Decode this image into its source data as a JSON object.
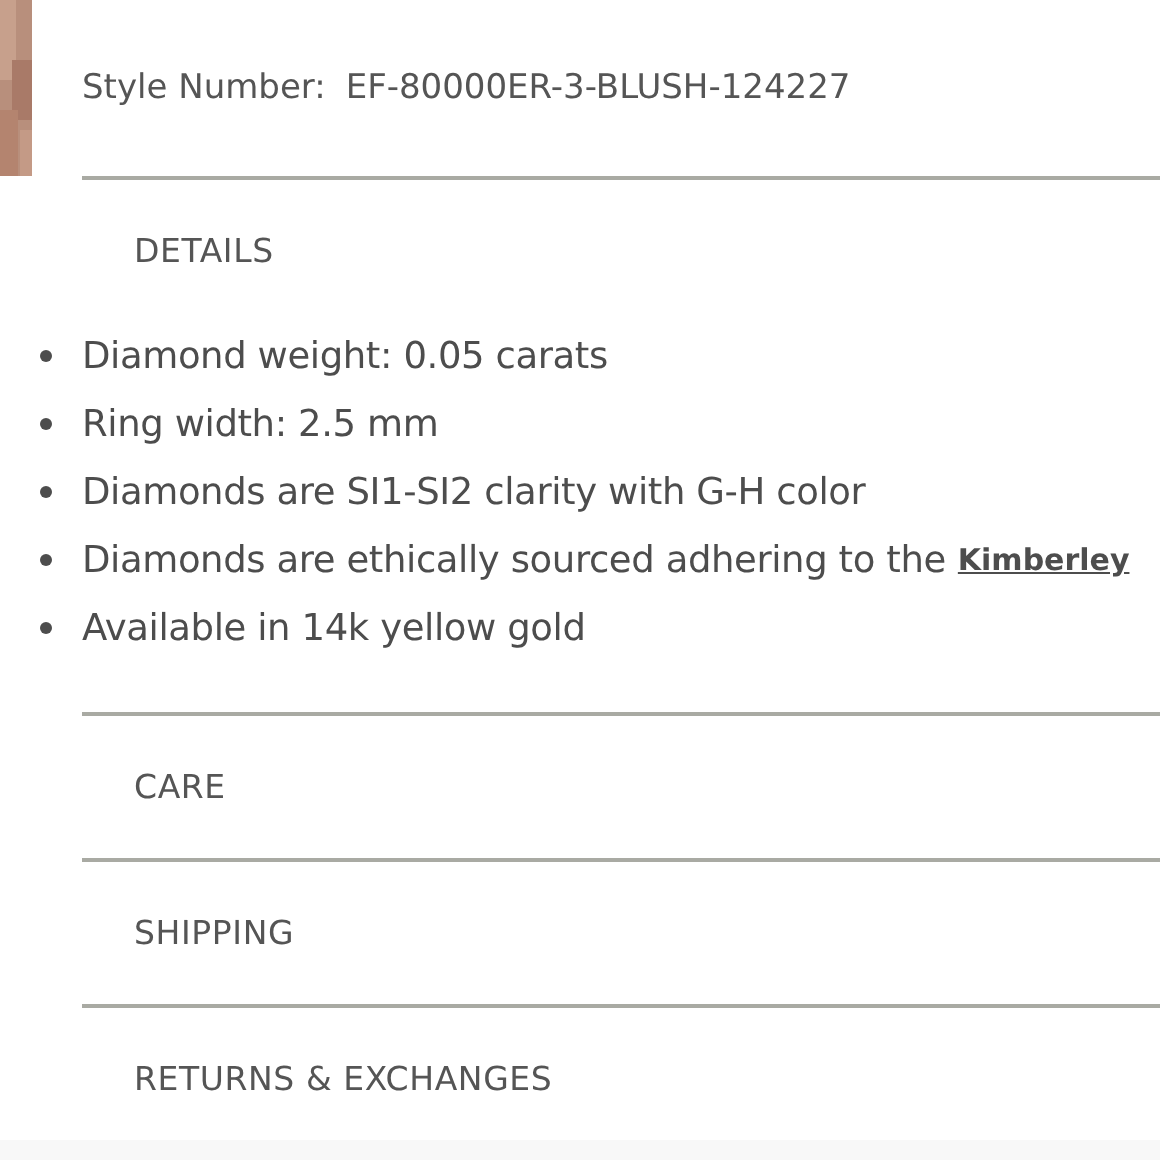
{
  "style_number": {
    "label": "Style Number:",
    "value": "EF-80000ER-3-BLUSH-124227"
  },
  "sections": [
    {
      "title": "DETAILS",
      "items": [
        {
          "text": "Diamond weight: 0.05 carats"
        },
        {
          "text": "Ring width: 2.5 mm"
        },
        {
          "text": "Diamonds are SI1-SI2 clarity with G-H color"
        },
        {
          "text": "Diamonds are ethically sourced adhering to the",
          "link": "Kimberley"
        },
        {
          "text": "Available in 14k yellow gold"
        }
      ]
    },
    {
      "title": "CARE"
    },
    {
      "title": "SHIPPING"
    },
    {
      "title": "RETURNS & EXCHANGES"
    }
  ]
}
